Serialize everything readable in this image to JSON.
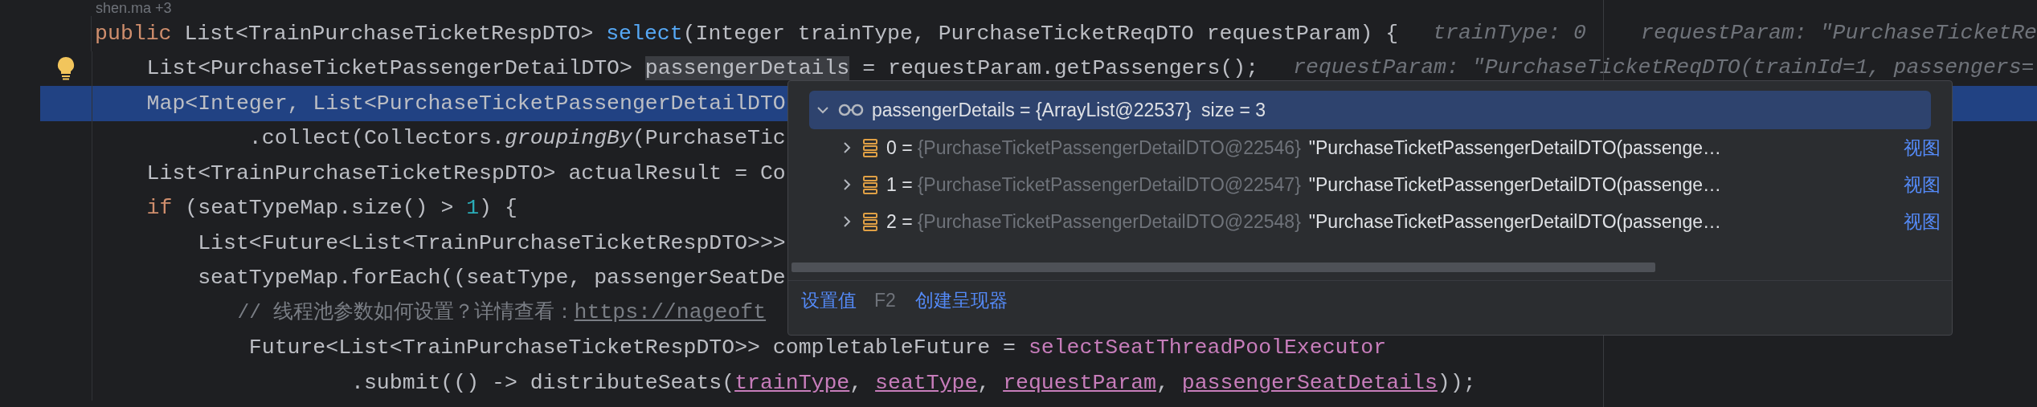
{
  "editor": {
    "author_hint": "shen.ma +3",
    "lines": [
      {
        "selected": false,
        "lightbulb": false,
        "tokens": [
          {
            "kind": "keyword",
            "text": "public "
          },
          {
            "kind": "plain",
            "text": "List<TrainPurchaseTicketRespDTO> "
          },
          {
            "kind": "method",
            "text": "select"
          },
          {
            "kind": "plain",
            "text": "(Integer trainType, PurchaseTicketReqDTO requestParam) {"
          }
        ],
        "hints": [
          "trainType: 0",
          "requestParam: \"PurchaseTicketRe"
        ]
      },
      {
        "selected": false,
        "lightbulb": true,
        "tokens": [
          {
            "kind": "plain",
            "text": "    List<PurchaseTicketPassengerDetailDTO> "
          },
          {
            "kind": "usage",
            "text": "passengerDetails"
          },
          {
            "kind": "plain",
            "text": " = requestParam.getPassengers();"
          }
        ],
        "hints": [
          "requestParam: \"PurchaseTicketReqDTO(trainId=1, passengers="
        ]
      },
      {
        "selected": true,
        "lightbulb": false,
        "tokens": [
          {
            "kind": "plain",
            "text": "    Map<Integer, List<PurchaseTicketPassengerDetailDTO"
          }
        ]
      },
      {
        "selected": false,
        "lightbulb": false,
        "tokens": [
          {
            "kind": "plain",
            "text": "            .collect(Collectors."
          },
          {
            "kind": "italic",
            "text": "groupingBy"
          },
          {
            "kind": "plain",
            "text": "(PurchaseTic"
          }
        ]
      },
      {
        "selected": false,
        "lightbulb": false,
        "tokens": [
          {
            "kind": "plain",
            "text": "    List<TrainPurchaseTicketRespDTO> actualResult = Co"
          }
        ]
      },
      {
        "selected": false,
        "lightbulb": false,
        "tokens": [
          {
            "kind": "keyword",
            "text": "    if "
          },
          {
            "kind": "plain",
            "text": "(seatTypeMap.size() > "
          },
          {
            "kind": "number",
            "text": "1"
          },
          {
            "kind": "plain",
            "text": ") {"
          }
        ]
      },
      {
        "selected": false,
        "lightbulb": false,
        "tokens": [
          {
            "kind": "plain",
            "text": "        List<Future<List<TrainPurchaseTicketRespDTO>>>"
          }
        ]
      },
      {
        "selected": false,
        "lightbulb": false,
        "tokens": [
          {
            "kind": "plain",
            "text": "        seatTypeMap.forEach((seatType, passengerSeatDe"
          }
        ]
      },
      {
        "selected": false,
        "lightbulb": false,
        "tokens": [
          {
            "kind": "comment",
            "text": "            // 线程池参数如何设置？详情查看："
          },
          {
            "kind": "link",
            "text": "https://nageoft"
          }
        ]
      },
      {
        "selected": false,
        "lightbulb": false,
        "tokens": [
          {
            "kind": "plain",
            "text": "            Future<List<TrainPurchaseTicketRespDTO>> completableFuture = "
          },
          {
            "kind": "field",
            "text": "selectSeatThreadPoolExecutor"
          }
        ]
      },
      {
        "selected": false,
        "lightbulb": false,
        "tokens": [
          {
            "kind": "plain",
            "text": "                    .submit(() -> distributeSeats("
          },
          {
            "kind": "param",
            "text": "trainType"
          },
          {
            "kind": "plain",
            "text": ", "
          },
          {
            "kind": "param",
            "text": "seatType"
          },
          {
            "kind": "plain",
            "text": ", "
          },
          {
            "kind": "param",
            "text": "requestParam"
          },
          {
            "kind": "plain",
            "text": ", "
          },
          {
            "kind": "param",
            "text": "passengerSeatDetails"
          },
          {
            "kind": "plain",
            "text": "));"
          }
        ]
      }
    ]
  },
  "popup": {
    "root": {
      "name": "passengerDetails",
      "equals": "=",
      "value": "{ArrayList@22537}",
      "size": "size = 3",
      "expanded": true,
      "selected": true,
      "children": [
        {
          "index": "0",
          "equals": "=",
          "ref": "{PurchaseTicketPassengerDetailDTO@22546}",
          "value": "\"PurchaseTicketPassengerDetailDTO(passenge…",
          "link": "视图",
          "expanded": false,
          "selected": false
        },
        {
          "index": "1",
          "equals": "=",
          "ref": "{PurchaseTicketPassengerDetailDTO@22547}",
          "value": "\"PurchaseTicketPassengerDetailDTO(passenge…",
          "link": "视图",
          "expanded": false,
          "selected": false
        },
        {
          "index": "2",
          "equals": "=",
          "ref": "{PurchaseTicketPassengerDetailDTO@22548}",
          "value": "\"PurchaseTicketPassengerDetailDTO(passenge…",
          "link": "视图",
          "expanded": false,
          "selected": false
        }
      ]
    },
    "actions": [
      {
        "label": "设置值",
        "shortcut": "F2"
      },
      {
        "label": "创建呈现器"
      }
    ]
  }
}
